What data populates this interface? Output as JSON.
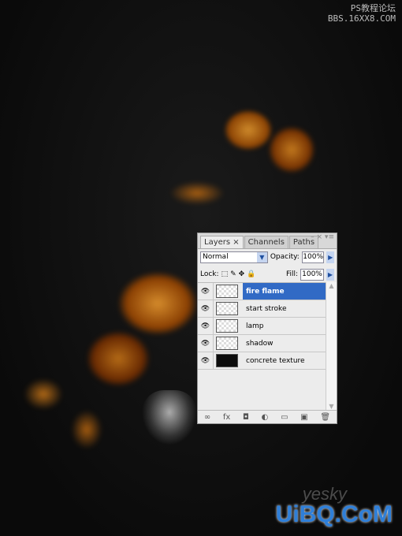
{
  "watermarks": {
    "top_line1": "PS教程论坛",
    "top_line2": "BBS.16XX8.COM",
    "bottom": "UiBQ.CoM",
    "bottom_faint": "yesky"
  },
  "panel": {
    "tabs": [
      {
        "label": "Layers ×",
        "active": true
      },
      {
        "label": "Channels"
      },
      {
        "label": "Paths"
      }
    ],
    "window_buttons": "– × ▾≡",
    "blend_mode": "Normal",
    "opacity_label": "Opacity:",
    "opacity": "100%",
    "lock_label": "Lock:",
    "fill_label": "Fill:",
    "fill": "100%",
    "lock_icons": [
      "lock-transparent-icon",
      "lock-image-icon",
      "lock-position-icon",
      "lock-all-icon"
    ],
    "layers": [
      {
        "name": "fire flame",
        "selected": true,
        "thumb": "transparent"
      },
      {
        "name": "start stroke",
        "thumb": "transparent"
      },
      {
        "name": "lamp",
        "thumb": "transparent"
      },
      {
        "name": "shadow",
        "thumb": "transparent"
      },
      {
        "name": "concrete texture",
        "thumb": "dark"
      }
    ],
    "bottom_icons": [
      "link-icon",
      "fx-icon",
      "mask-icon",
      "adjustment-icon",
      "group-icon",
      "new-layer-icon",
      "trash-icon"
    ],
    "bottom_glyphs": [
      "∞",
      "fx",
      "◘",
      "◐",
      "▭",
      "▣",
      "🗑"
    ]
  },
  "colors": {
    "accent": "#316ac5",
    "flame": "#e08a1a"
  }
}
